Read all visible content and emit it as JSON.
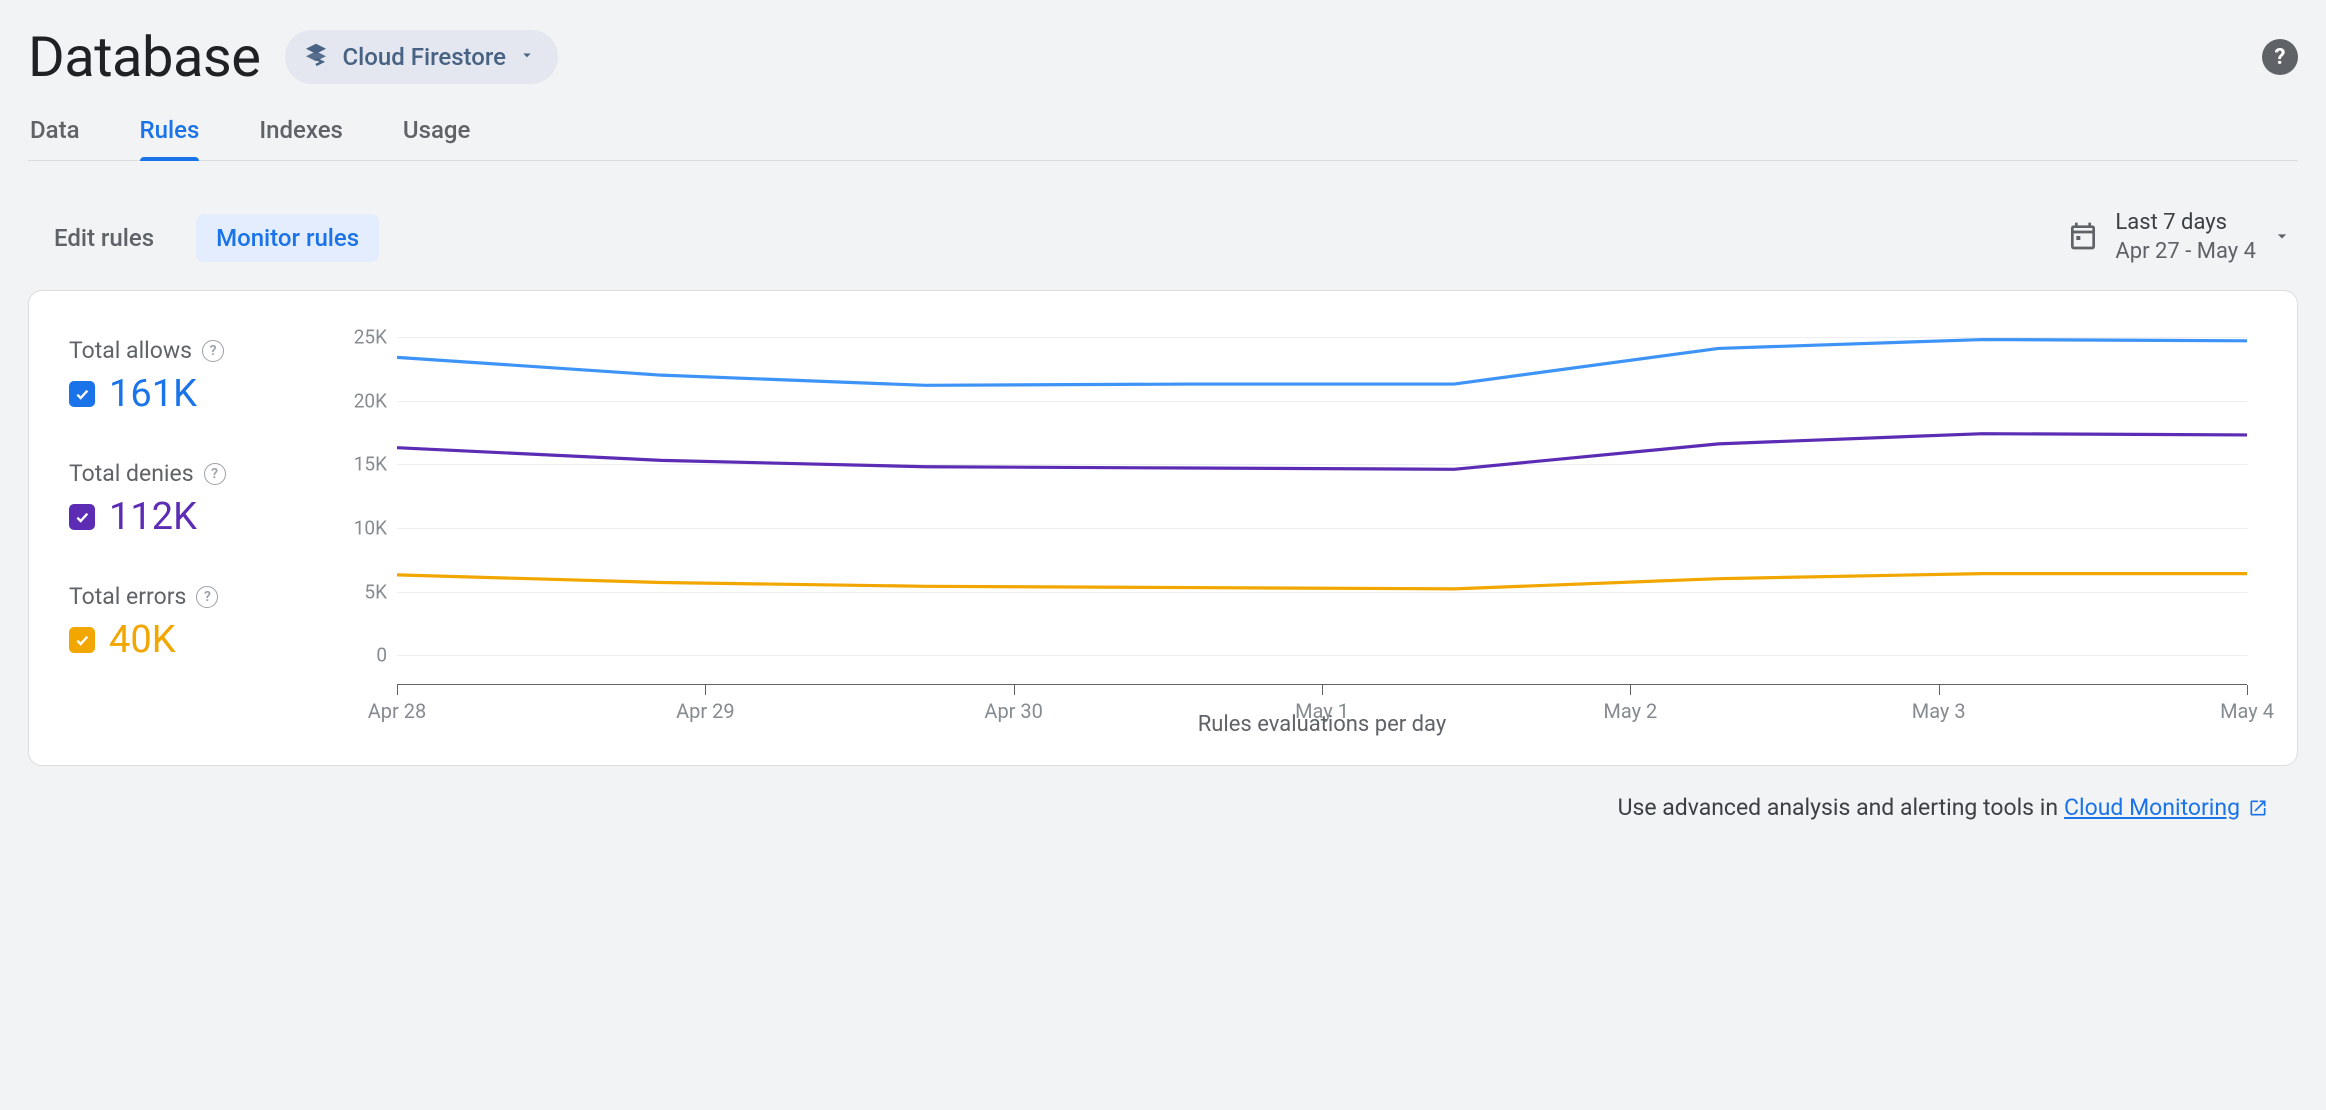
{
  "header": {
    "title": "Database",
    "selector_label": "Cloud Firestore"
  },
  "tabs": {
    "main": [
      "Data",
      "Rules",
      "Indexes",
      "Usage"
    ],
    "main_active_index": 1,
    "sub": [
      "Edit rules",
      "Monitor rules"
    ],
    "sub_active_index": 1
  },
  "date_picker": {
    "line1": "Last 7 days",
    "line2": "Apr 27 - May 4"
  },
  "legend": [
    {
      "label": "Total allows",
      "value": "161K",
      "color": "#1a73e8"
    },
    {
      "label": "Total denies",
      "value": "112K",
      "color": "#5c2db4"
    },
    {
      "label": "Total errors",
      "value": "40K",
      "color": "#f2a600"
    }
  ],
  "chart_data": {
    "type": "line",
    "xlabel": "Rules evaluations per day",
    "ylabel": "",
    "ylim": [
      0,
      25000
    ],
    "categories": [
      "Apr 28",
      "Apr 29",
      "Apr 30",
      "May 1",
      "May 2",
      "May 3",
      "May 4"
    ],
    "yticks": [
      0,
      5000,
      10000,
      15000,
      20000,
      25000
    ],
    "ytick_labels": [
      "0",
      "5K",
      "10K",
      "15K",
      "20K",
      "25K"
    ],
    "series": [
      {
        "name": "Total allows",
        "color": "#3d94f6",
        "values": [
          23400,
          22000,
          21200,
          21300,
          21300,
          24100,
          24800,
          24700
        ]
      },
      {
        "name": "Total denies",
        "color": "#5c2db4",
        "values": [
          16300,
          15300,
          14800,
          14700,
          14600,
          16600,
          17400,
          17300
        ]
      },
      {
        "name": "Total errors",
        "color": "#f2a600",
        "values": [
          6300,
          5700,
          5400,
          5300,
          5200,
          6000,
          6400,
          6400
        ]
      }
    ]
  },
  "footer": {
    "text": "Use advanced analysis and alerting tools in ",
    "link": "Cloud Monitoring"
  }
}
